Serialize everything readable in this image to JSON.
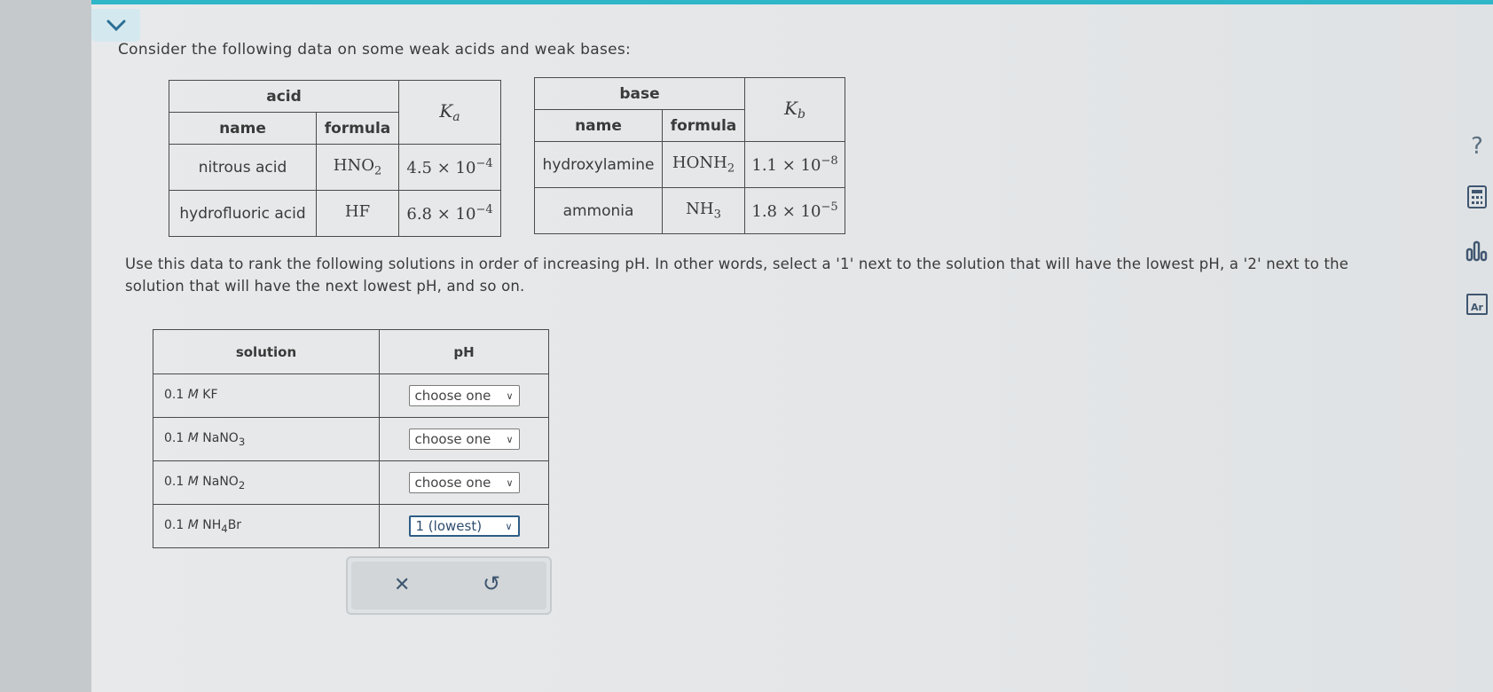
{
  "prompt": "Consider the following data on some weak acids and weak bases:",
  "acid_table": {
    "group_header": "acid",
    "name_header": "name",
    "formula_header": "formula",
    "k_symbol": "K",
    "k_sub": "a",
    "rows": [
      {
        "name": "nitrous acid",
        "formula": "HNO",
        "formula_sub": "2",
        "k_base": "4.5 × 10",
        "k_exp": "−4"
      },
      {
        "name": "hydrofluoric acid",
        "formula": "HF",
        "formula_sub": "",
        "k_base": "6.8 × 10",
        "k_exp": "−4"
      }
    ]
  },
  "base_table": {
    "group_header": "base",
    "name_header": "name",
    "formula_header": "formula",
    "k_symbol": "K",
    "k_sub": "b",
    "rows": [
      {
        "name": "hydroxylamine",
        "formula": "HONH",
        "formula_sub": "2",
        "k_base": "1.1 × 10",
        "k_exp": "−8"
      },
      {
        "name": "ammonia",
        "formula": "NH",
        "formula_sub": "3",
        "k_base": "1.8 × 10",
        "k_exp": "−5"
      }
    ]
  },
  "instructions": "Use this data to rank the following solutions in order of increasing pH. In other words, select a '1' next to the solution that will have the lowest pH, a '2' next to the solution that will have the next lowest pH, and so on.",
  "solution_table": {
    "solution_header": "solution",
    "ph_header": "pH",
    "rows": [
      {
        "conc": "0.1",
        "unit": "M",
        "formula": "KF",
        "sub": "",
        "tail": "",
        "selected": "choose one"
      },
      {
        "conc": "0.1",
        "unit": "M",
        "formula": "NaNO",
        "sub": "3",
        "tail": "",
        "selected": "choose one"
      },
      {
        "conc": "0.1",
        "unit": "M",
        "formula": "NaNO",
        "sub": "2",
        "tail": "",
        "selected": "choose one"
      },
      {
        "conc": "0.1",
        "unit": "M",
        "formula": "NH",
        "sub": "4",
        "tail": "Br",
        "selected": "1 (lowest)"
      }
    ]
  },
  "actions": {
    "clear_symbol": "✕",
    "undo_symbol": "↺"
  },
  "side_tools": {
    "help_symbol": "?",
    "periodic_label": "Ar"
  },
  "colors": {
    "accent": "#2fb6c9",
    "select_border": "#2e5d86"
  }
}
